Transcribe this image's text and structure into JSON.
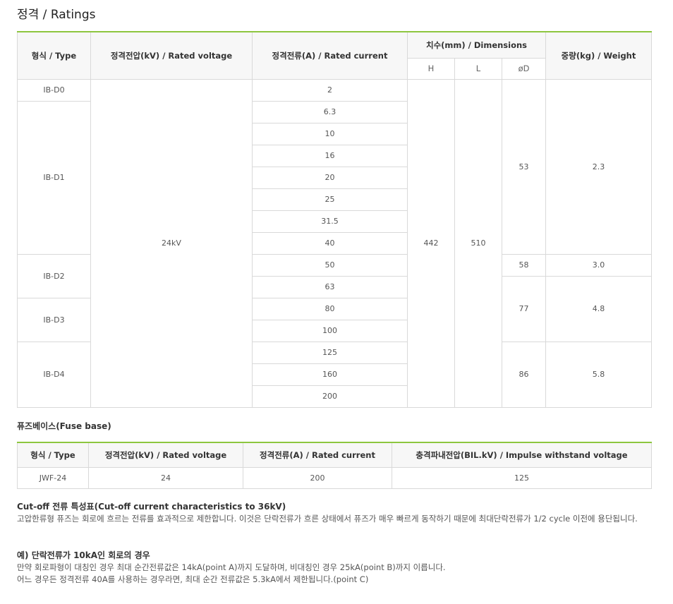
{
  "title": "정격 / Ratings",
  "ratings": {
    "headers": {
      "type": "형식 / Type",
      "voltage": "정격전압(kV) / Rated voltage",
      "current": "정격전류(A) / Rated current",
      "dimensions": "치수(mm) / Dimensions",
      "h": "H",
      "l": "L",
      "d": "øD",
      "weight": "중량(kg) / Weight"
    },
    "voltage": "24kV",
    "h": "442",
    "l": "510",
    "types": [
      "IB-D0",
      "IB-D1",
      "IB-D2",
      "IB-D3",
      "IB-D4"
    ],
    "currents": [
      "2",
      "6.3",
      "10",
      "16",
      "20",
      "25",
      "31.5",
      "40",
      "50",
      "63",
      "80",
      "100",
      "125",
      "160",
      "200"
    ],
    "diameters": [
      "53",
      "58",
      "77",
      "86"
    ],
    "weights": [
      "2.3",
      "3.0",
      "4.8",
      "5.8"
    ]
  },
  "fuse_base": {
    "label": "퓨즈베이스(Fuse base)",
    "headers": {
      "type": "형식 / Type",
      "voltage": "정격전압(kV) / Rated voltage",
      "current": "정격전류(A) / Rated current",
      "bil": "충격파내전압(BIL.kV) / Impulse withstand voltage"
    },
    "row": {
      "type": "JWF-24",
      "voltage": "24",
      "current": "200",
      "bil": "125"
    }
  },
  "cutoff": {
    "heading": "Cut-off 전류 특성표(Cut-off current characteristics to 36kV)",
    "text": "고압한류형 퓨즈는 회로에 흐르는 전류를 효과적으로 제한합니다. 이것은 단락전류가 흐른 상태에서 퓨즈가 매우 빠르게 동작하기 때문에 최대단락전류가 1/2 cycle 이전에 용단됩니다."
  },
  "example": {
    "heading": "예) 단락전류가 10kA인 회로의 경우",
    "line1": "만약 회로파형이 대칭인 경우 최대 순간전류값은 14kA(point A)까지 도달하며, 비대칭인 경우 25kA(point B)까지 이릅니다.",
    "line2": "어느 경우든 정격전류 40A를 사용하는 경우라면, 최대 순간 전류값은 5.3kA에서 제한됩니다.(point C)"
  }
}
